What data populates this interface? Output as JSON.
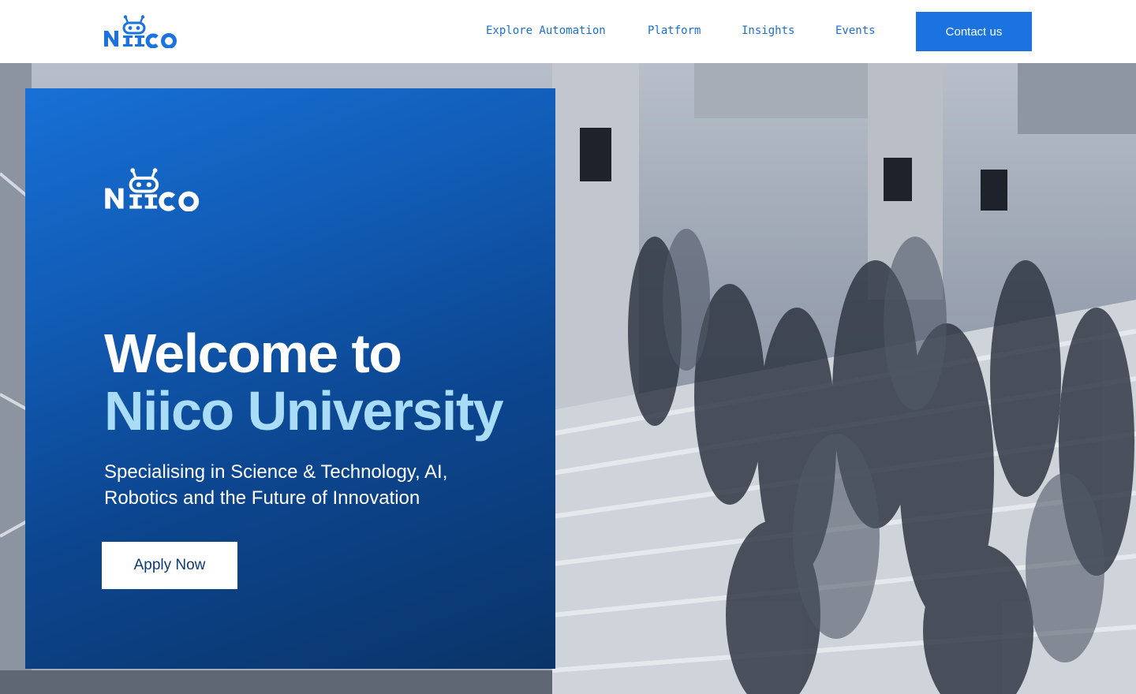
{
  "brand": {
    "name": "Niico",
    "accent": "#1a73e0",
    "light_accent": "#a9dcf7"
  },
  "nav": {
    "items": [
      {
        "label": "Explore Automation"
      },
      {
        "label": "Platform"
      },
      {
        "label": "Insights"
      },
      {
        "label": "Events"
      }
    ],
    "contact_label": "Contact us"
  },
  "hero": {
    "heading_line1": "Welcome to",
    "heading_line2": "Niico University",
    "subtitle": "Specialising in Science & Technology, AI, Robotics and the Future of Innovation",
    "cta_label": "Apply Now",
    "background": "robot-logo-icon crowd-on-stairs-photo"
  }
}
